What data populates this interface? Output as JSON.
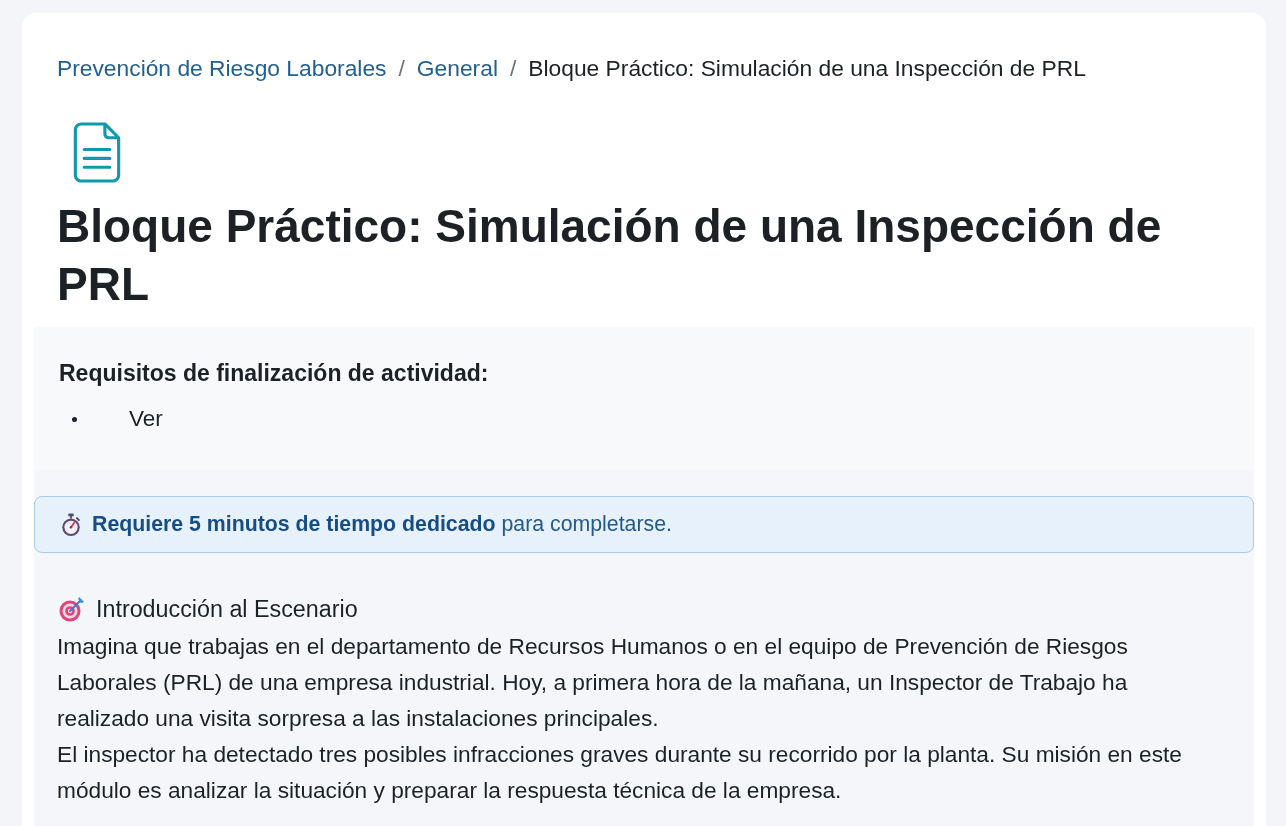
{
  "breadcrumb": {
    "items": [
      {
        "label": "Prevención de Riesgo Laborales",
        "kind": "link"
      },
      {
        "label": "General",
        "kind": "link"
      },
      {
        "label": "Bloque Práctico: Simulación de una Inspección de PRL",
        "kind": "current"
      }
    ],
    "separators": [
      "/",
      "/"
    ]
  },
  "activity": {
    "title": "Bloque Práctico: Simulación de una Inspección de PRL"
  },
  "completion": {
    "heading": "Requisitos de finalización de actividad:",
    "requirements": [
      "Ver"
    ]
  },
  "notice": {
    "text": "**Requiere 5 minutos de tiempo dedicado** para completarse."
  },
  "intro": {
    "heading": "Introducción al Escenario",
    "paragraphs": [
      "Imagina que trabajas en el departamento de Recursos Humanos o en el equipo de Prevención de Riesgos Laborales (PRL) de una empresa industrial. Hoy, a primera hora de la mañana, un Inspector de Trabajo ha realizado una visita sorpresa a las instalaciones principales.",
      "El inspector ha detectado tres posibles infracciones graves durante su recorrido por la planta. Su misión en este módulo es analizar la situación y preparar la respuesta técnica de la empresa."
    ]
  }
}
